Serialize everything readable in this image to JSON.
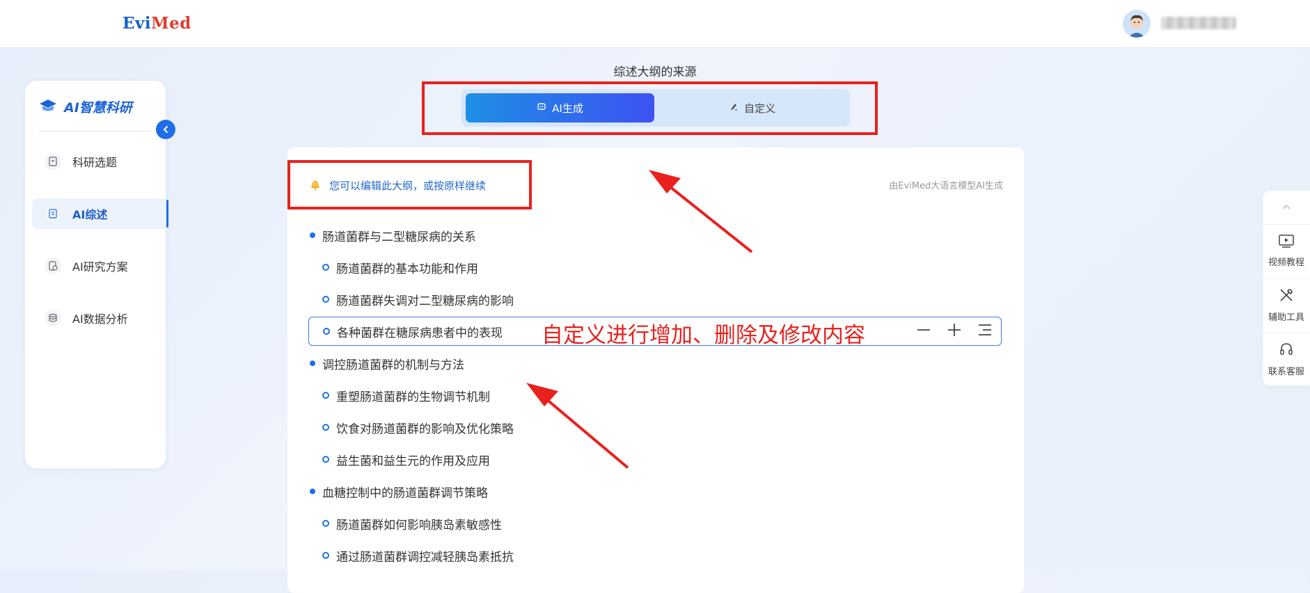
{
  "brand": {
    "logo_part1": "Evi",
    "logo_part2": "Med"
  },
  "sidebar": {
    "title": "AI智慧科研",
    "items": [
      {
        "label": "科研选题",
        "icon": "bookmark-icon",
        "active": false
      },
      {
        "label": "AI综述",
        "icon": "document-icon",
        "active": true
      },
      {
        "label": "AI研究方案",
        "icon": "clipboard-icon",
        "active": false
      },
      {
        "label": "AI数据分析",
        "icon": "database-icon",
        "active": false
      }
    ]
  },
  "source": {
    "title": "综述大纲的来源",
    "options": [
      {
        "label": "AI生成",
        "selected": true
      },
      {
        "label": "自定义",
        "selected": false
      }
    ]
  },
  "outline": {
    "hint": "您可以编辑此大纲，或按原样继续",
    "generated_by": "由EviMed大语言模型AI生成",
    "items": [
      {
        "level": 1,
        "text": "肠道菌群与二型糖尿病的关系"
      },
      {
        "level": 2,
        "text": "肠道菌群的基本功能和作用"
      },
      {
        "level": 2,
        "text": "肠道菌群失调对二型糖尿病的影响"
      },
      {
        "level": 2,
        "text": "各种菌群在糖尿病患者中的表现",
        "editing": true
      },
      {
        "level": 1,
        "text": "调控肠道菌群的机制与方法"
      },
      {
        "level": 2,
        "text": "重塑肠道菌群的生物调节机制"
      },
      {
        "level": 2,
        "text": "饮食对肠道菌群的影响及优化策略"
      },
      {
        "level": 2,
        "text": "益生菌和益生元的作用及应用"
      },
      {
        "level": 1,
        "text": "血糖控制中的肠道菌群调节策略"
      },
      {
        "level": 2,
        "text": "肠道菌群如何影响胰岛素敏感性"
      },
      {
        "level": 2,
        "text": "通过肠道菌群调控减轻胰岛素抵抗"
      }
    ]
  },
  "annotation": {
    "text": "自定义进行增加、删除及修改内容",
    "color": "#e8211d"
  },
  "rightbar": {
    "items": [
      {
        "label": "视频教程",
        "icon": "video-icon"
      },
      {
        "label": "辅助工具",
        "icon": "tools-icon"
      },
      {
        "label": "联系客服",
        "icon": "headset-icon"
      }
    ]
  },
  "colors": {
    "accent": "#1f6ee8",
    "annotation_red": "#e8211d"
  }
}
